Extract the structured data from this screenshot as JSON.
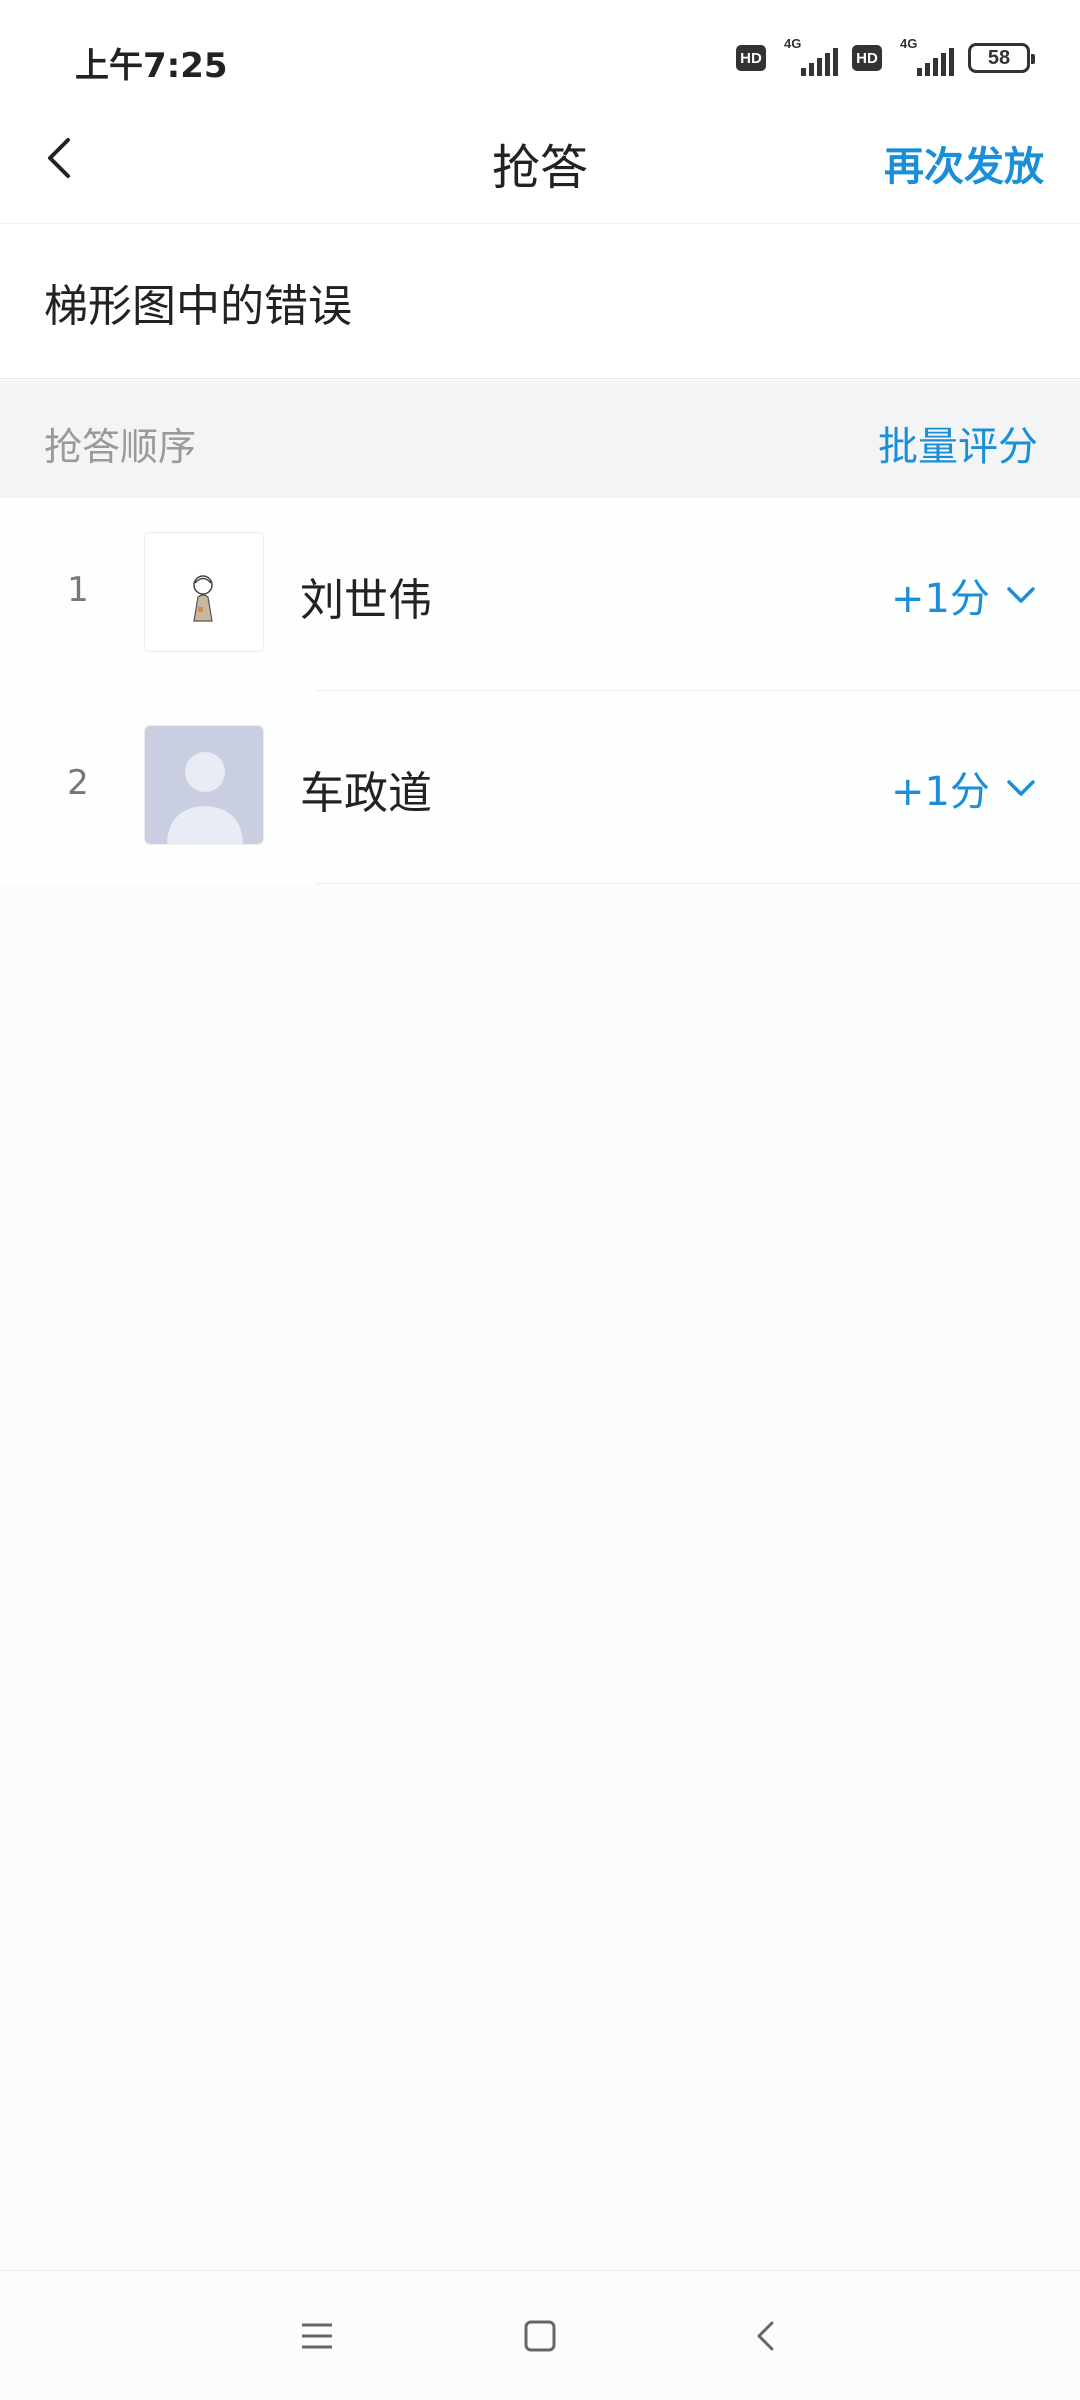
{
  "status_bar": {
    "time": "上午7:25",
    "hd1": "HD",
    "net1": "4G",
    "hd2": "HD",
    "net2": "4G",
    "battery": "58"
  },
  "nav": {
    "title": "抢答",
    "redistribute_label": "再次发放"
  },
  "question": {
    "title": "梯形图中的错误"
  },
  "section": {
    "label": "抢答顺序",
    "batch_label": "批量评分"
  },
  "answers": [
    {
      "rank": "1",
      "name": "刘世伟",
      "score": "+1分",
      "avatar": "sketch-avatar"
    },
    {
      "rank": "2",
      "name": "车政道",
      "score": "+1分",
      "avatar": "default-avatar"
    }
  ],
  "colors": {
    "accent": "#1a8fd8",
    "background": "#fbfcfc",
    "section_bg": "#f3f4f6"
  }
}
